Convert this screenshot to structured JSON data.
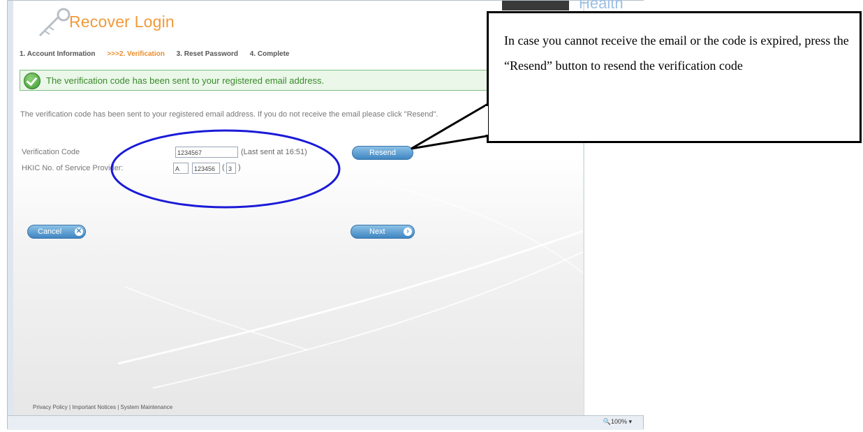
{
  "page": {
    "title": "Recover Login",
    "brand_partial": "Health"
  },
  "steps": [
    {
      "label": "1. Account Information",
      "active": false
    },
    {
      "label": ">>>2. Verification",
      "active": true
    },
    {
      "label": "3. Reset Password",
      "active": false
    },
    {
      "label": "4. Complete",
      "active": false
    }
  ],
  "alert": {
    "message": "The verification code has been sent to your registered email address.",
    "icon": "check-circle-icon"
  },
  "description": "The verification code has been sent to your registered email address. If you do not receive the email please click \"Resend\".",
  "form": {
    "verification_label": "Verification Code",
    "verification_value": "1234567",
    "last_sent": "(Last sent at 16:51)",
    "resend_label": "Resend",
    "hkic_label": "HKIC No. of Service Provider:",
    "hkic_prefix": "A",
    "hkic_number": "123456",
    "hkic_check_open": "(",
    "hkic_check_digit": "3",
    "hkic_check_close": ")"
  },
  "buttons": {
    "cancel_label": "Cancel",
    "next_label": "Next"
  },
  "footer": {
    "links_text": "Privacy Policy | Important Notices | System Maintenance"
  },
  "status_bar": {
    "zoom": "100%"
  },
  "callout": {
    "text": "In case you cannot receive the email or the code is expired, press the “Resend” button to resend the verification code"
  },
  "colors": {
    "title_orange": "#f19a3a",
    "success_green": "#3a8a2a",
    "button_blue": "#3f86c2",
    "annotation_ellipse": "#1a1ad8"
  }
}
